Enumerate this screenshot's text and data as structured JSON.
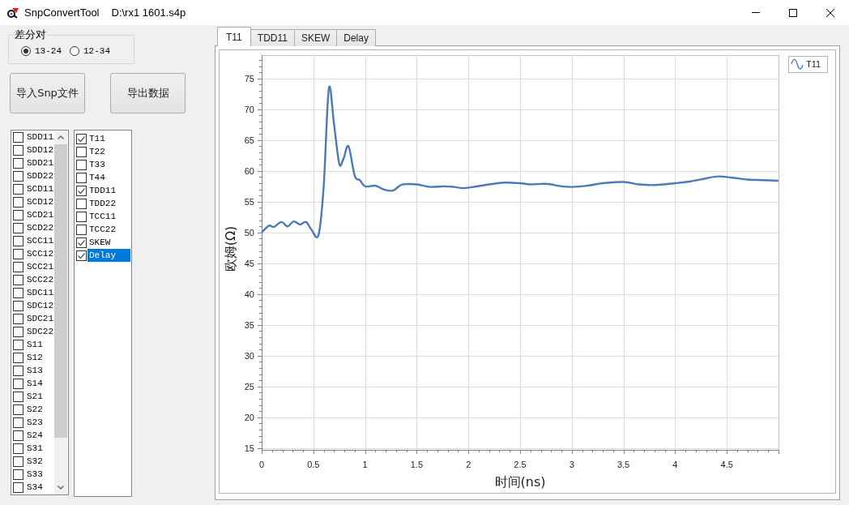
{
  "window": {
    "title": "SnpConvertTool",
    "file_path": "D:\\rx1 1601.s4p"
  },
  "pair_group": {
    "label": "差分对",
    "options": [
      {
        "label": "13-24",
        "selected": true
      },
      {
        "label": "12-34",
        "selected": false
      }
    ]
  },
  "buttons": [
    {
      "label": "导入Snp文件"
    },
    {
      "label": "导出数据"
    }
  ],
  "s_parameter_list": [
    {
      "label": "SDD11",
      "checked": false,
      "selected": false
    },
    {
      "label": "SDD12",
      "checked": false,
      "selected": false
    },
    {
      "label": "SDD21",
      "checked": false,
      "selected": false
    },
    {
      "label": "SDD22",
      "checked": false,
      "selected": false
    },
    {
      "label": "SCD11",
      "checked": false,
      "selected": false
    },
    {
      "label": "SCD12",
      "checked": false,
      "selected": false
    },
    {
      "label": "SCD21",
      "checked": false,
      "selected": false
    },
    {
      "label": "SCD22",
      "checked": false,
      "selected": false
    },
    {
      "label": "SCC11",
      "checked": false,
      "selected": false
    },
    {
      "label": "SCC12",
      "checked": false,
      "selected": false
    },
    {
      "label": "SCC21",
      "checked": false,
      "selected": false
    },
    {
      "label": "SCC22",
      "checked": false,
      "selected": false
    },
    {
      "label": "SDC11",
      "checked": false,
      "selected": false
    },
    {
      "label": "SDC12",
      "checked": false,
      "selected": false
    },
    {
      "label": "SDC21",
      "checked": false,
      "selected": false
    },
    {
      "label": "SDC22",
      "checked": false,
      "selected": false
    },
    {
      "label": "S11",
      "checked": false,
      "selected": false
    },
    {
      "label": "S12",
      "checked": false,
      "selected": false
    },
    {
      "label": "S13",
      "checked": false,
      "selected": false
    },
    {
      "label": "S14",
      "checked": false,
      "selected": false
    },
    {
      "label": "S21",
      "checked": false,
      "selected": false
    },
    {
      "label": "S22",
      "checked": false,
      "selected": false
    },
    {
      "label": "S23",
      "checked": false,
      "selected": false
    },
    {
      "label": "S24",
      "checked": false,
      "selected": false
    },
    {
      "label": "S31",
      "checked": false,
      "selected": false
    },
    {
      "label": "S32",
      "checked": false,
      "selected": false
    },
    {
      "label": "S33",
      "checked": false,
      "selected": false
    },
    {
      "label": "S34",
      "checked": false,
      "selected": false
    }
  ],
  "t_parameter_list": [
    {
      "label": "T11",
      "checked": true,
      "selected": false
    },
    {
      "label": "T22",
      "checked": false,
      "selected": false
    },
    {
      "label": "T33",
      "checked": false,
      "selected": false
    },
    {
      "label": "T44",
      "checked": false,
      "selected": false
    },
    {
      "label": "TDD11",
      "checked": true,
      "selected": false
    },
    {
      "label": "TDD22",
      "checked": false,
      "selected": false
    },
    {
      "label": "TCC11",
      "checked": false,
      "selected": false
    },
    {
      "label": "TCC22",
      "checked": false,
      "selected": false
    },
    {
      "label": "SKEW",
      "checked": true,
      "selected": false
    },
    {
      "label": "Delay",
      "checked": true,
      "selected": true
    }
  ],
  "tabs": [
    {
      "label": "T11",
      "selected": true
    },
    {
      "label": "TDD11",
      "selected": false
    },
    {
      "label": "SKEW",
      "selected": false
    },
    {
      "label": "Delay",
      "selected": false
    }
  ],
  "chart": {
    "chart_data": {
      "type": "line",
      "xlabel": "时间(ns)",
      "ylabel": "欧姆(Ω)",
      "grid": true,
      "x": [
        0,
        0.07,
        0.12,
        0.19,
        0.25,
        0.31,
        0.37,
        0.43,
        0.48,
        0.55,
        0.6,
        0.65,
        0.7,
        0.75,
        0.79,
        0.84,
        0.9,
        0.95,
        1.0,
        1.1,
        1.18,
        1.27,
        1.36,
        1.5,
        1.63,
        1.76,
        1.86,
        1.95,
        2.05,
        2.2,
        2.35,
        2.5,
        2.6,
        2.75,
        2.9,
        3.0,
        3.15,
        3.3,
        3.5,
        3.65,
        3.8,
        4.0,
        4.15,
        4.3,
        4.42,
        4.55,
        4.7,
        4.85,
        5.0
      ],
      "series": [
        {
          "name": "T11",
          "color": "#4d7ab7",
          "values": [
            50,
            51.1,
            50.9,
            51.7,
            51.0,
            51.8,
            51.3,
            51.7,
            50.5,
            49.6,
            57.5,
            73.4,
            67.6,
            61.2,
            61.9,
            64.0,
            59.2,
            58.5,
            57.5,
            57.6,
            57.0,
            56.8,
            57.8,
            57.8,
            57.4,
            57.5,
            57.4,
            57.2,
            57.4,
            57.8,
            58.1,
            58.0,
            57.8,
            57.9,
            57.5,
            57.4,
            57.6,
            58.0,
            58.2,
            57.8,
            57.7,
            58.0,
            58.3,
            58.8,
            59.1,
            58.9,
            58.6,
            58.5,
            58.4
          ]
        }
      ],
      "xlim": [
        0,
        5
      ],
      "ylim": [
        14.7,
        78.8
      ],
      "xticks": [
        0,
        0.5,
        1,
        1.5,
        2,
        2.5,
        3,
        3.5,
        4,
        4.5
      ],
      "yticks": [
        15,
        20,
        25,
        30,
        35,
        40,
        45,
        50,
        55,
        60,
        65,
        70,
        75
      ]
    }
  }
}
